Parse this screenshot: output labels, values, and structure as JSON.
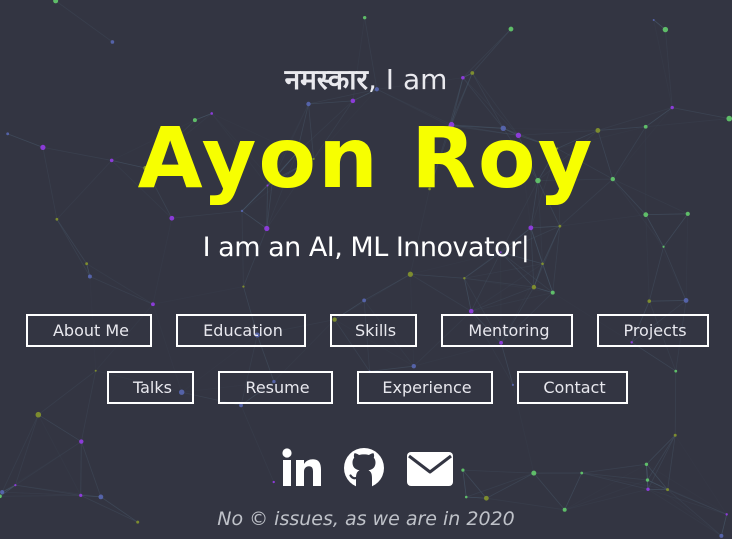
{
  "hero": {
    "greeting_hindi": "नमस्कार",
    "greeting_rest": ", I am",
    "name": "Ayon Roy",
    "tagline": "I am an AI, ML Innovator",
    "caret": "|"
  },
  "nav": {
    "about": "About Me",
    "education": "Education",
    "skills": "Skills",
    "mentoring": "Mentoring",
    "projects": "Projects",
    "talks": "Talks",
    "resume": "Resume",
    "experience": "Experience",
    "contact": "Contact"
  },
  "social": [
    "linkedin-icon",
    "github-icon",
    "envelope-icon"
  ],
  "footer": {
    "text": "No © issues, as we are in 2020"
  },
  "colors": {
    "background": "#333542",
    "accent": "#f7ff00",
    "text": "#ffffff",
    "particle_line": "#4a5c6e",
    "particle_dots": [
      "#66d36e",
      "#9a3cf0",
      "#8a9a2a",
      "#5a6ab8"
    ]
  }
}
